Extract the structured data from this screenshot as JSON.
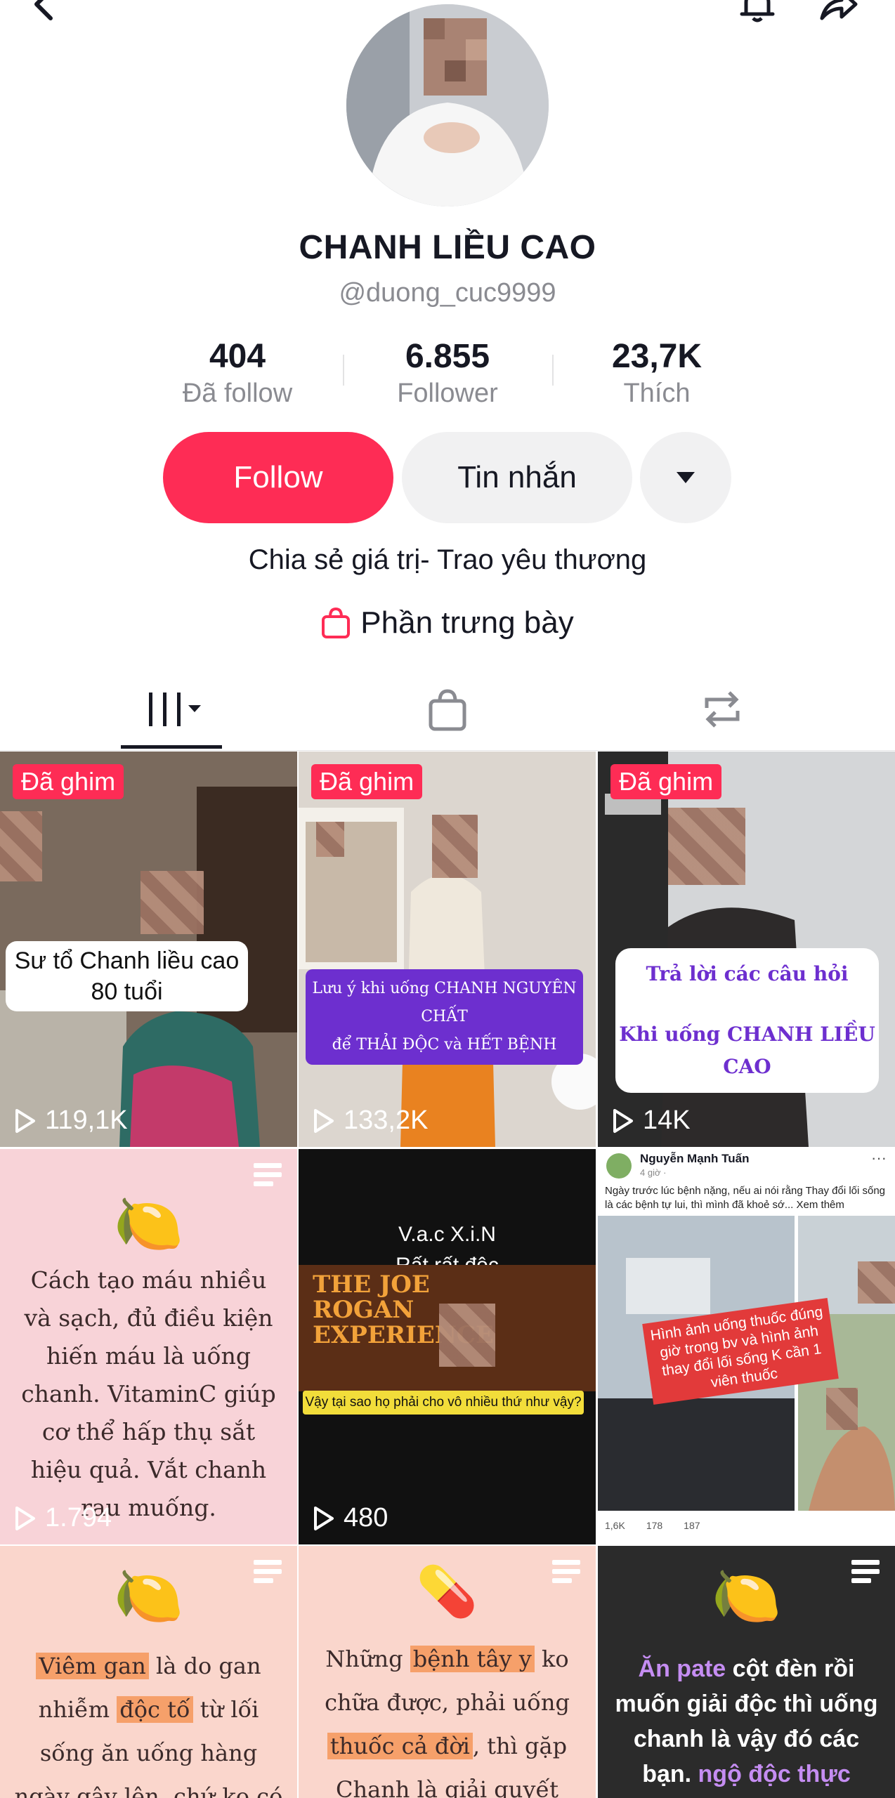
{
  "header": {
    "back_icon": "chevron-left-icon",
    "bell_icon": "bell-icon",
    "share_icon": "share-arrow-icon"
  },
  "profile": {
    "name": "CHANH LIỀU CAO",
    "handle": "@duong_cuc9999",
    "bio": "Chia sẻ giá trị- Trao yêu thương",
    "showcase": "Phần trưng bày"
  },
  "stats": [
    {
      "value": "404",
      "label": "Đã follow"
    },
    {
      "value": "6.855",
      "label": "Follower"
    },
    {
      "value": "23,7K",
      "label": "Thích"
    }
  ],
  "buttons": {
    "follow": "Follow",
    "message": "Tin nhắn"
  },
  "colors": {
    "accent": "#fe2c55",
    "pin_bg": "#fe2c55",
    "pink_bg": "#f8d3d8"
  },
  "videos": [
    {
      "pinned": "Đã ghim",
      "views": "119,1K",
      "caption": "Sư tổ Chanh liều cao 80 tuổi"
    },
    {
      "pinned": "Đã ghim",
      "views": "133,2K",
      "caption_line1": "Lưu ý khi uống CHANH NGUYÊN CHẤT",
      "caption_line2": "để THẢI ĐỘC và HẾT BỆNH"
    },
    {
      "pinned": "Đã ghim",
      "views": "14K",
      "caption_line1": "Trả lời các câu hỏi",
      "caption_line2": "Khi uống CHANH LIỀU CAO"
    },
    {
      "views": "1.794",
      "text": "Cách tạo máu nhiều và sạch, đủ điều kiện hiến máu là uống chanh. VitaminC giúp cơ thể hấp thụ sắt hiệu quả. Vắt chanh rau muống."
    },
    {
      "views": "480",
      "title1": "V.a.c  X.i.N",
      "title2": "Rất rất độc",
      "sign": "THE JOE ROGAN EXPERIENCE",
      "subtitle": "Vậy tại sao họ phải cho vô nhiều thứ như vậy?"
    },
    {
      "author": "Nguyễn Mạnh Tuấn",
      "time": "4 giờ ·",
      "post": "Ngày trước lúc bệnh nặng, nếu ai nói rằng Thay đổi lối sống là các bệnh tự lui, thì mình đã khoẻ sớ... Xem thêm",
      "overlay": "Hình ảnh uống thuốc đúng giờ trong bv và hình ảnh thay đổi lối sống K cần 1 viên thuốc",
      "likes": "1,6K",
      "comments": "178",
      "shares": "187"
    },
    {
      "text_parts": [
        "Viêm gan",
        " là do gan nhiễm ",
        "độc tố",
        " từ lối sống ăn uống hàng ngày gây lên, chứ ko có con virut"
      ]
    },
    {
      "text_parts": [
        "Những ",
        "bệnh tây y",
        " ko chữa được, phải uống ",
        "thuốc cả đời",
        ", thì gặp Chanh là giải quyết vấn"
      ]
    },
    {
      "text_parts": [
        "Ăn pate",
        " cột đèn rồi muốn giải độc thì uống chanh là vậy đó các bạn. ",
        "ngộ độc thực"
      ]
    }
  ]
}
